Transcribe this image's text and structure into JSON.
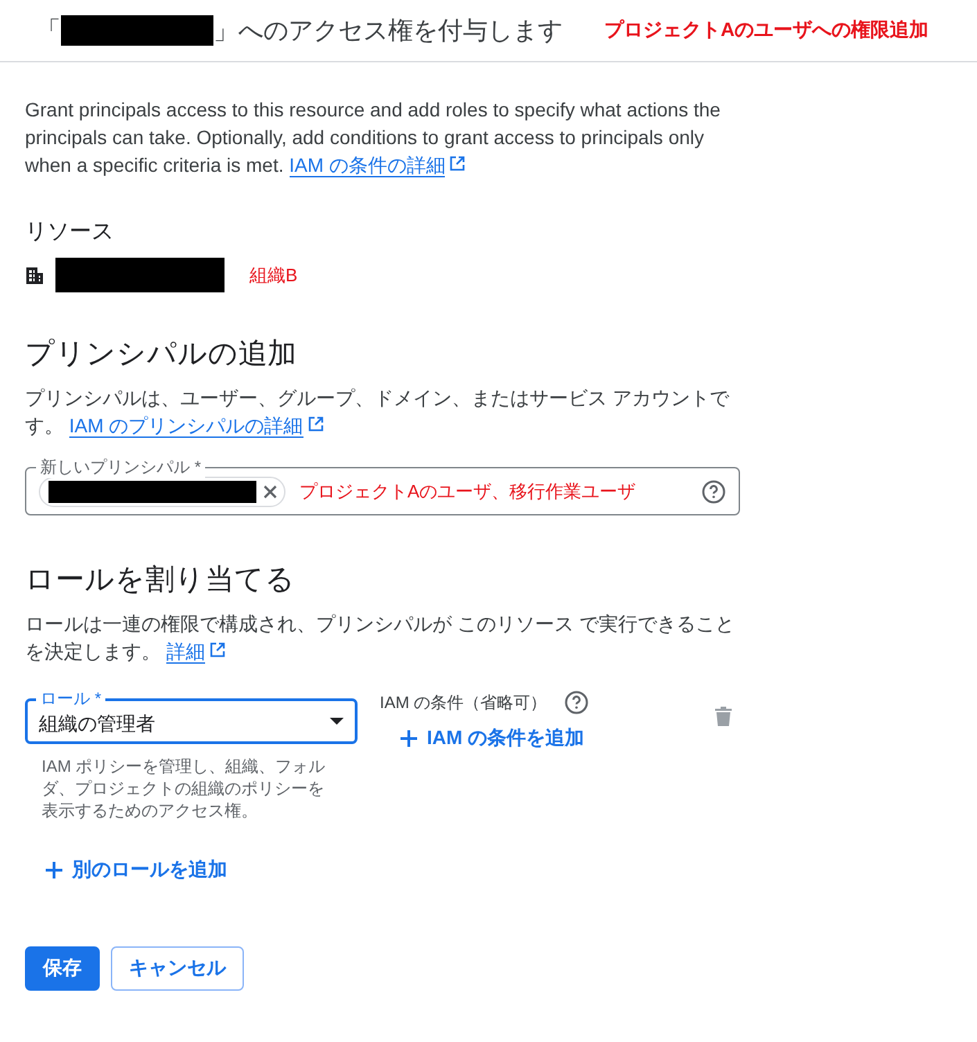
{
  "header": {
    "title_open": "「",
    "title_rest": "」へのアクセス権を付与します",
    "annotation": "プロジェクトAのユーザへの権限追加"
  },
  "intro": {
    "text": "Grant principals access to this resource and add roles to specify what actions the principals can take. Optionally, add conditions to grant access to principals only when a specific criteria is met.",
    "link": "IAM の条件の詳細"
  },
  "resource": {
    "heading": "リソース",
    "annotation": "組織B"
  },
  "principals": {
    "heading": "プリンシパルの追加",
    "text": "プリンシパルは、ユーザー、グループ、ドメイン、またはサービス アカウントです。",
    "link": "IAM のプリンシパルの詳細",
    "field": {
      "label": "新しいプリンシパル *",
      "annotation": "プロジェクトAのユーザ、移行作業ユーザ"
    }
  },
  "roles": {
    "heading": "ロールを割り当てる",
    "text": "ロールは一連の権限で構成され、プリンシパルが このリソース で実行できることを決定します。",
    "link": "詳細",
    "role": {
      "label": "ロール *",
      "value": "組織の管理者",
      "focused": true,
      "description": "IAM ポリシーを管理し、組織、フォルダ、プロジェクトの組織のポリシーを表示するためのアクセス権。"
    },
    "condition": {
      "label": "IAM の条件（省略可）",
      "add": "IAM の条件を追加"
    },
    "add_role": "別のロールを追加"
  },
  "buttons": [
    {
      "label": "保存",
      "kind": "primary"
    },
    {
      "label": "キャンセル",
      "kind": "secondary"
    }
  ]
}
